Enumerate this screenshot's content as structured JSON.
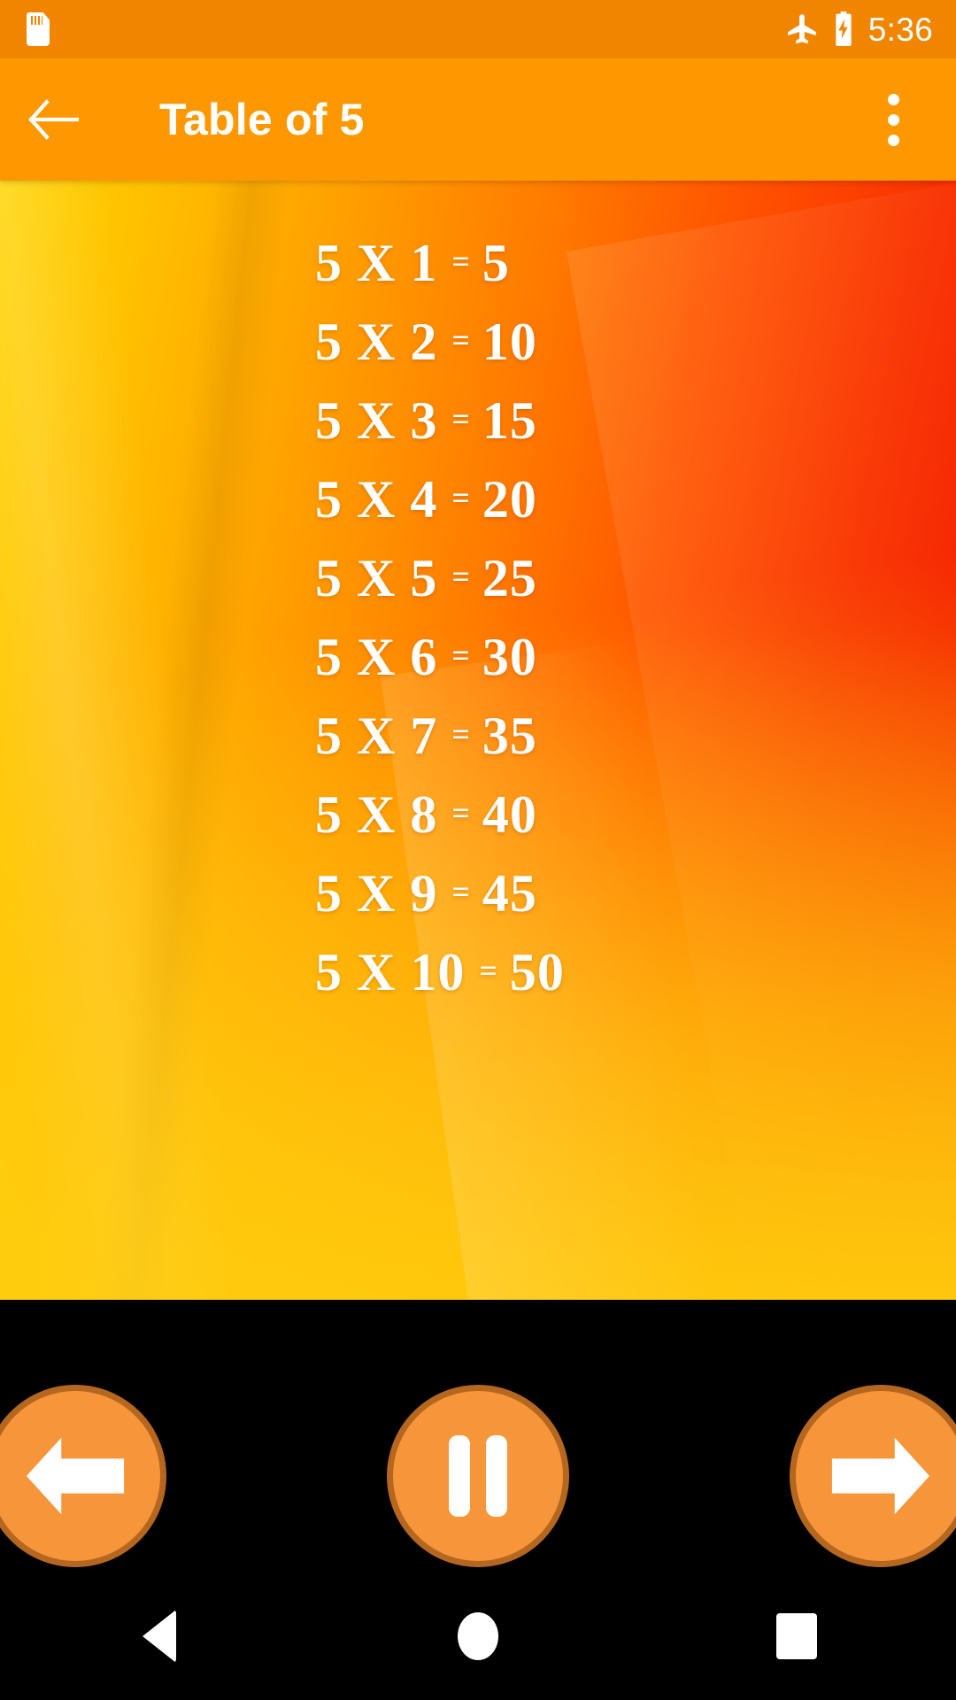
{
  "status_bar": {
    "sd_card_icon": "sd-card-icon",
    "airplane_icon": "airplane-mode-icon",
    "battery_icon": "battery-charging-icon",
    "time": "5:36",
    "background_color": "#F28500"
  },
  "app_bar": {
    "back_icon": "back-arrow-icon",
    "title": "Table of 5",
    "overflow_icon": "overflow-menu-icon",
    "background_color": "#FF9800"
  },
  "background": {
    "gradient_start": "#FFD400",
    "gradient_mid": "#FF7B00",
    "gradient_end": "#F21400"
  },
  "table": {
    "multiplier": "5",
    "operator": "X",
    "equals": "=",
    "rows": [
      {
        "lhs": "5 X 1",
        "eq": "=",
        "rhs": "5"
      },
      {
        "lhs": "5 X 2",
        "eq": "=",
        "rhs": "10"
      },
      {
        "lhs": "5 X 3",
        "eq": "=",
        "rhs": "15"
      },
      {
        "lhs": "5 X 4",
        "eq": "=",
        "rhs": "20"
      },
      {
        "lhs": "5 X 5",
        "eq": "=",
        "rhs": "25"
      },
      {
        "lhs": "5 X 6",
        "eq": "=",
        "rhs": "30"
      },
      {
        "lhs": "5 X 7",
        "eq": "=",
        "rhs": "35"
      },
      {
        "lhs": "5 X 8",
        "eq": "=",
        "rhs": "40"
      },
      {
        "lhs": "5 X 9",
        "eq": "=",
        "rhs": "45"
      },
      {
        "lhs": "5 X 10",
        "eq": "=",
        "rhs": "50"
      }
    ]
  },
  "controls": {
    "previous_icon": "arrow-left-icon",
    "pause_icon": "pause-icon",
    "next_icon": "arrow-right-icon",
    "fill_color": "#F7953A",
    "border_color": "#B5671F"
  },
  "nav_bar": {
    "back_icon": "nav-back-icon",
    "home_icon": "nav-home-icon",
    "recents_icon": "nav-recents-icon",
    "background_color": "#000000"
  }
}
